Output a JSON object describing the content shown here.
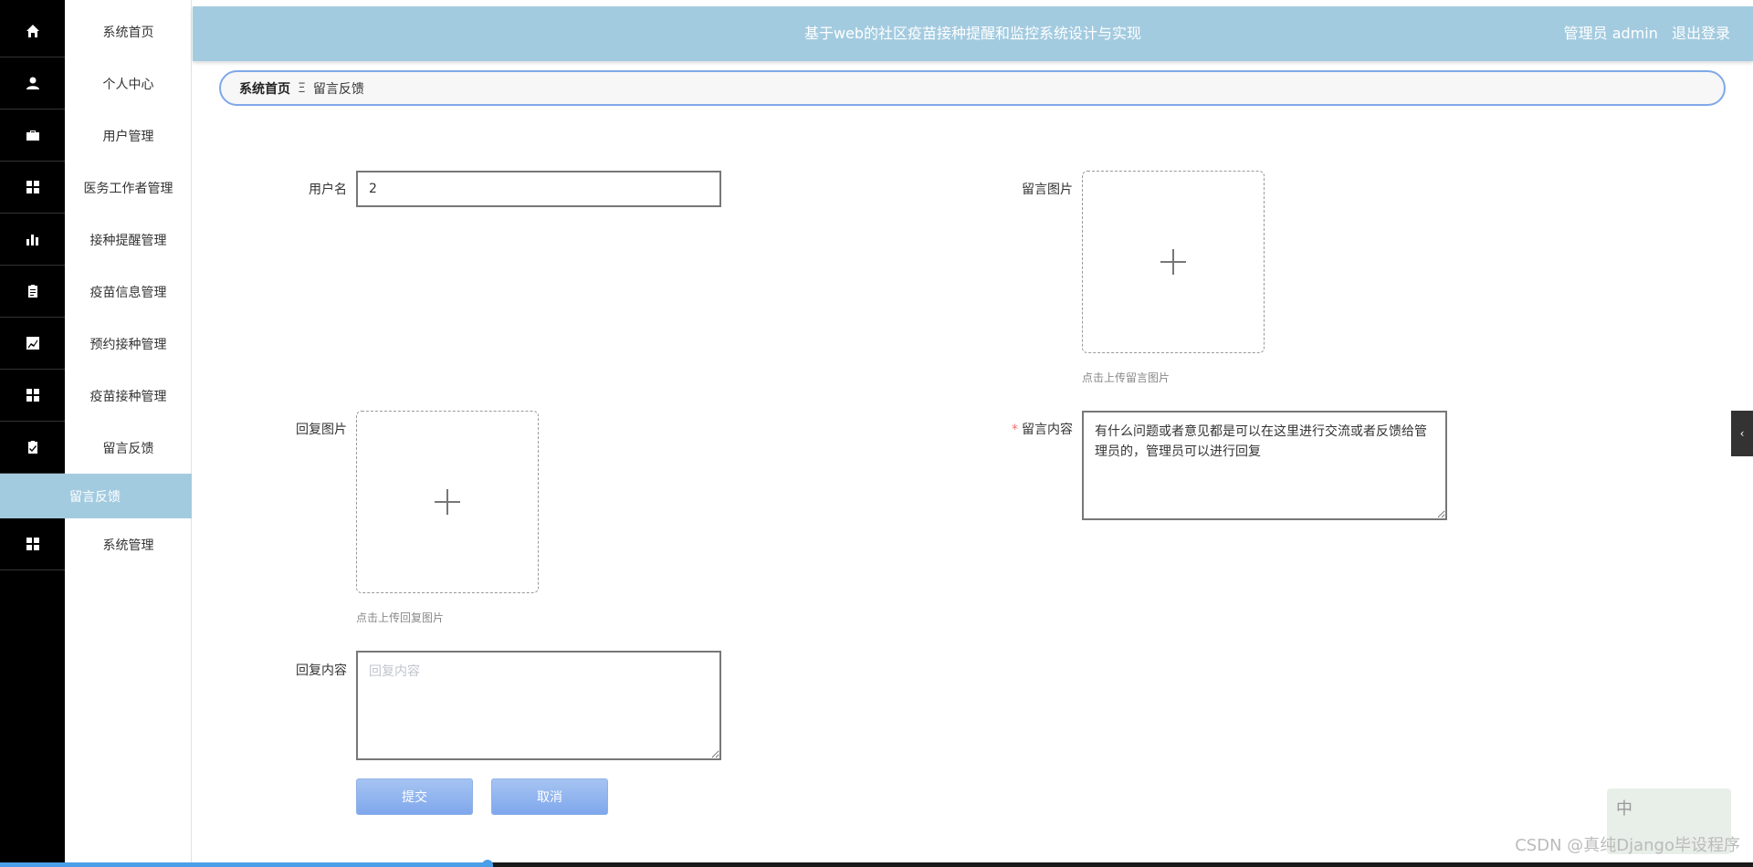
{
  "header": {
    "title": "基于web的社区疫苗接种提醒和监控系统设计与实现",
    "role": "管理员 admin",
    "logout": "退出登录"
  },
  "sidebar": {
    "items": [
      {
        "label": "系统首页",
        "icon": "home-icon"
      },
      {
        "label": "个人中心",
        "icon": "user-icon"
      },
      {
        "label": "用户管理",
        "icon": "briefcase-icon"
      },
      {
        "label": "医务工作者管理",
        "icon": "grid-icon"
      },
      {
        "label": "接种提醒管理",
        "icon": "bar-chart-icon"
      },
      {
        "label": "疫苗信息管理",
        "icon": "clipboard-icon"
      },
      {
        "label": "预约接种管理",
        "icon": "line-chart-icon"
      },
      {
        "label": "疫苗接种管理",
        "icon": "grid-icon"
      },
      {
        "label": "留言反馈",
        "icon": "clipboard-check-icon"
      },
      {
        "label": "系统管理",
        "icon": "grid-icon"
      }
    ],
    "active_sub": "留言反馈"
  },
  "breadcrumb": {
    "home": "系统首页",
    "separator": "Ξ",
    "current": "留言反馈"
  },
  "form": {
    "username_label": "用户名",
    "username_value": "2",
    "image_label": "留言图片",
    "image_tip": "点击上传留言图片",
    "reply_image_label": "回复图片",
    "reply_image_tip": "点击上传回复图片",
    "content_required": "*",
    "content_label": "留言内容",
    "content_value": "有什么问题或者意见都是可以在这里进行交流或者反馈给管理员的，管理员可以进行回复",
    "reply_label": "回复内容",
    "reply_placeholder": "回复内容",
    "submit": "提交",
    "cancel": "取消"
  },
  "watermark": "CSDN @真纯Django毕设程序",
  "ime": "中",
  "side_tab": "‹",
  "colors": {
    "header": "#a3cbe0",
    "button": "#7fa7ec",
    "sidebar": "#000000"
  }
}
